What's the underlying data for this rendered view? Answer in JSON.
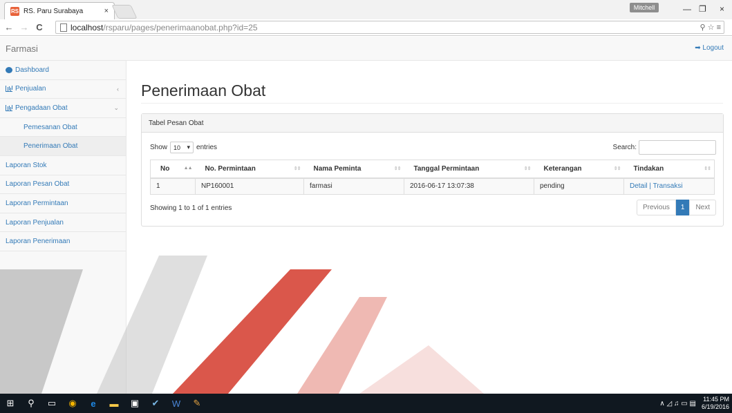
{
  "browser": {
    "tab_title": "RS. Paru Surabaya",
    "tab_close": "×",
    "favicon": "RS",
    "user_badge": "Mitchell",
    "url_host": "localhost",
    "url_path": "/rsparu/pages/penerimaanobat.php?id=25",
    "min": "—",
    "restore": "❐",
    "close": "×",
    "back": "←",
    "forward": "→",
    "reload": "C",
    "omni_right": "⚲ ☆ ≡"
  },
  "navbar": {
    "brand": "Farmasi",
    "logout": "➡ Logout"
  },
  "sidebar": {
    "items": [
      {
        "label": "Dashboard",
        "icon": "dashboard-icon"
      },
      {
        "label": "Penjualan",
        "icon": "bar-chart-icon",
        "chevron": "‹"
      },
      {
        "label": "Pengadaan Obat",
        "icon": "bar-chart-icon",
        "chevron": "⌄"
      },
      {
        "label": "Pemesanan Obat"
      },
      {
        "label": "Penerimaan Obat"
      },
      {
        "label": "Laporan Stok"
      },
      {
        "label": "Laporan Pesan Obat"
      },
      {
        "label": "Laporan Permintaan"
      },
      {
        "label": "Laporan Penjualan"
      },
      {
        "label": "Laporan Penerimaan"
      }
    ]
  },
  "main": {
    "title": "Penerimaan Obat",
    "panel_heading": "Tabel Pesan Obat",
    "show": "Show",
    "entries_value": "10",
    "entries": "entries",
    "search_label": "Search:",
    "columns": [
      "No",
      "No. Permintaan",
      "Nama Peminta",
      "Tanggal Permintaan",
      "Keterangan",
      "Tindakan"
    ],
    "rows": [
      {
        "no": "1",
        "permintaan": "NP160001",
        "nama": "farmasi",
        "tanggal": "2016-06-17 13:07:38",
        "ket": "pending",
        "detail": "Detail",
        "sep": " | ",
        "transaksi": "Transaksi"
      }
    ],
    "info": "Showing 1 to 1 of 1 entries",
    "pager": {
      "prev": "Previous",
      "page": "1",
      "next": "Next"
    }
  },
  "taskbar": {
    "time": "11:45 PM",
    "date": "6/19/2016",
    "tray": "∧ ◿ ♫ ▭ ▤"
  },
  "colors": {
    "link": "#337ab7",
    "watermark_red": "#d33a2c",
    "watermark_gray": "#9a9a9a"
  }
}
